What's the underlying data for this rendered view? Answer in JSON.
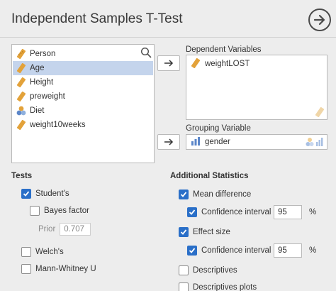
{
  "header": {
    "title": "Independent Samples T-Test"
  },
  "variables": [
    {
      "name": "Person",
      "type": "nominal"
    },
    {
      "name": "Age",
      "type": "scale",
      "selected": true
    },
    {
      "name": "Height",
      "type": "scale"
    },
    {
      "name": "preweight",
      "type": "scale"
    },
    {
      "name": "Diet",
      "type": "nominal-multi"
    },
    {
      "name": "weight10weeks",
      "type": "scale"
    }
  ],
  "dependent": {
    "label": "Dependent Variables",
    "items": [
      "weightLOST"
    ]
  },
  "grouping": {
    "label": "Grouping Variable",
    "value": "gender"
  },
  "tests": {
    "heading": "Tests",
    "student": "Student's",
    "bayes": "Bayes factor",
    "prior_label": "Prior",
    "prior_value": "0.707",
    "welch": "Welch's",
    "mann": "Mann-Whitney U"
  },
  "additional": {
    "heading": "Additional Statistics",
    "mean_diff": "Mean difference",
    "ci_label": "Confidence interval",
    "ci_value_1": "95",
    "pct_1": "%",
    "effect_size": "Effect size",
    "ci_value_2": "95",
    "pct_2": "%",
    "descriptives": "Descriptives",
    "descriptives_plots": "Descriptives plots"
  },
  "colors": {
    "accent": "#2a6fc8",
    "selection": "#c4d4ec",
    "scale_icon": "#e3a23a"
  },
  "icons": [
    "run-arrow-icon",
    "search-icon",
    "ruler-icon",
    "nominal-circles-icon",
    "arrow-right-icon",
    "bar-icon"
  ]
}
